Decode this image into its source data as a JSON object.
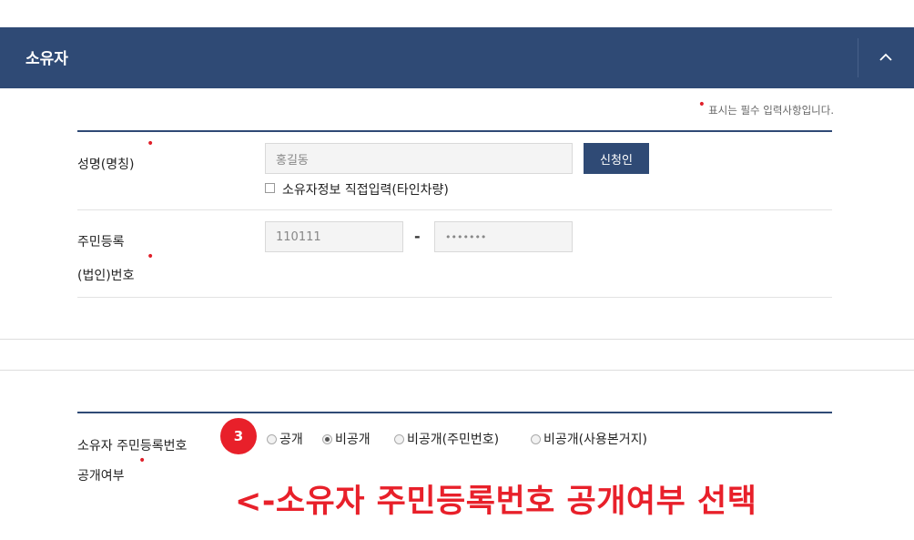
{
  "header": {
    "title": "소유자"
  },
  "required_note": {
    "marker": "•",
    "text": "표시는 필수 입력사항입니다."
  },
  "owner_form": {
    "name": {
      "label": "성명(명칭)",
      "value": "홍길동",
      "apply_button": "신청인",
      "checkbox_label": "소유자정보 직접입력(타인차량)"
    },
    "resident_number": {
      "label_line1": "주민등록",
      "label_line2": "(법인)번호",
      "front_value": "110111",
      "separator": "-",
      "back_value": "•••••••"
    }
  },
  "disclosure": {
    "label_line1": "소유자 주민등록번호",
    "label_line2": "공개여부",
    "step_badge": "3",
    "options": [
      {
        "label": "공개",
        "selected": false
      },
      {
        "label": "비공개",
        "selected": true
      },
      {
        "label": "비공개(주민번호)",
        "selected": false
      },
      {
        "label": "비공개(사용본거지)",
        "selected": false
      }
    ]
  },
  "annotation": {
    "text": "<-소유자 주민등록번호 공개여부 선택",
    "color": "#e8202a"
  },
  "colors": {
    "header_bg": "#2f4a75",
    "required": "#e0202a"
  }
}
